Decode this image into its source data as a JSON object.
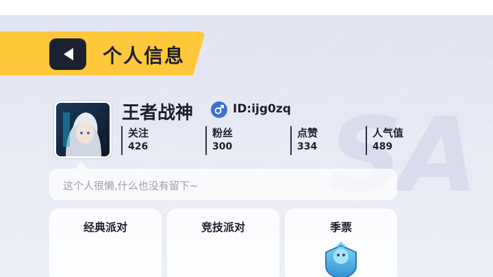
{
  "header": {
    "title": "个人信息",
    "back_icon": "back-arrow-icon"
  },
  "profile": {
    "username": "王者战神",
    "gender_icon": "male-icon",
    "id_text": "ID:ijg0zq",
    "bio": "这个人很懒,什么也没有留下~"
  },
  "stats": [
    {
      "label": "关注",
      "value": "426"
    },
    {
      "label": "粉丝",
      "value": "300"
    },
    {
      "label": "点赞",
      "value": "334"
    },
    {
      "label": "人气值",
      "value": "489"
    }
  ],
  "cards": [
    {
      "label": "经典派对"
    },
    {
      "label": "竞技派对"
    },
    {
      "label": "季票",
      "icon": "season-pass-badge-icon"
    }
  ],
  "colors": {
    "accent": "#ffc83a",
    "dark": "#1d2233",
    "gender": "#3b6fd6"
  }
}
